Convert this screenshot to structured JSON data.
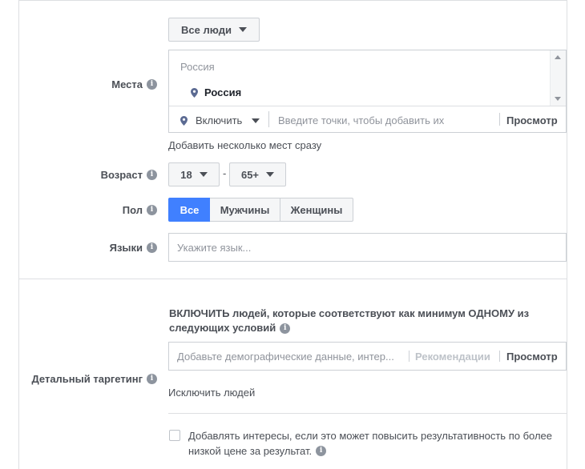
{
  "audience_selector": {
    "label": "Все люди"
  },
  "locations": {
    "label": "Места",
    "list_header": "Россия",
    "selected": [
      {
        "name": "Россия"
      }
    ],
    "include_label": "Включить",
    "input_placeholder": "Введите точки, чтобы добавить их",
    "browse_label": "Просмотр",
    "bulk_link": "Добавить несколько мест сразу"
  },
  "age": {
    "label": "Возраст",
    "min": "18",
    "separator": "-",
    "max": "65+"
  },
  "gender": {
    "label": "Пол",
    "options": [
      "Все",
      "Мужчины",
      "Женщины"
    ],
    "selected": "Все"
  },
  "languages": {
    "label": "Языки",
    "placeholder": "Укажите язык..."
  },
  "detailed_targeting": {
    "label": "Детальный таргетинг",
    "description_line1": "ВКЛЮЧИТЬ людей, которые соответствуют как минимум ОДНОМУ из",
    "description_line2": "следующих условий",
    "input_placeholder": "Добавьте демографические данные, интер...",
    "recommendations_label": "Рекомендации",
    "browse_label": "Просмотр",
    "exclude_link": "Исключить людей",
    "expand_interests_line1": "Добавлять интересы, если это может повысить результативность по более",
    "expand_interests_line2": "низкой цене за результат.",
    "expand_interests_checked": false
  },
  "icons": {
    "info": "info-icon",
    "pin": "location-pin-icon",
    "caret": "caret-down-icon"
  }
}
